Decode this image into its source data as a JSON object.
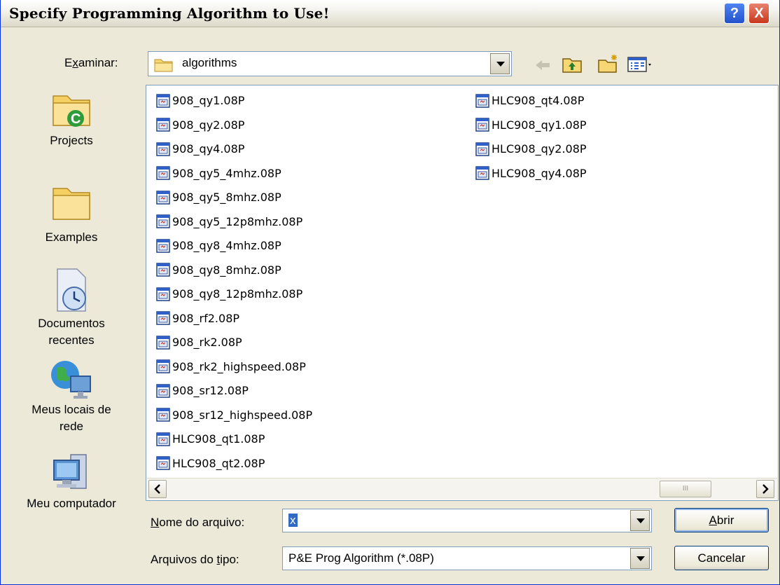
{
  "window": {
    "title": "Specify Programming Algorithm to Use!"
  },
  "titlebar_buttons": {
    "help": "?",
    "close": "X"
  },
  "look_in": {
    "label_pre": "E",
    "label_ul": "x",
    "label_post": "aminar:",
    "value": "algorithms"
  },
  "toolbar": {
    "icons": [
      "back-icon",
      "up-folder-icon",
      "new-folder-icon",
      "view-menu-icon"
    ]
  },
  "places": [
    {
      "label": "Projects",
      "icon": "projects-folder-icon"
    },
    {
      "label": "Examples",
      "icon": "folder-icon"
    },
    {
      "label": "Documentos recentes",
      "icon": "recent-documents-icon"
    },
    {
      "label": "Meus locais de rede",
      "icon": "network-places-icon"
    },
    {
      "label": "Meu computador",
      "icon": "my-computer-icon"
    }
  ],
  "files": {
    "column1": [
      "908_qy1.08P",
      "908_qy2.08P",
      "908_qy4.08P",
      "908_qy5_4mhz.08P",
      "908_qy5_8mhz.08P",
      "908_qy5_12p8mhz.08P",
      "908_qy8_4mhz.08P",
      "908_qy8_8mhz.08P",
      "908_qy8_12p8mhz.08P",
      "908_rf2.08P",
      "908_rk2.08P",
      "908_rk2_highspeed.08P",
      "908_sr12.08P",
      "908_sr12_highspeed.08P",
      "HLC908_qt1.08P",
      "HLC908_qt2.08P"
    ],
    "column2": [
      "HLC908_qt4.08P",
      "HLC908_qy1.08P",
      "HLC908_qy2.08P",
      "HLC908_qy4.08P"
    ]
  },
  "scrollbar": {
    "thumb_grip": "III"
  },
  "filename": {
    "label_ul": "N",
    "label_rest": "ome do arquivo:",
    "value": "x"
  },
  "filetype": {
    "label_pre": "Arquivos do ",
    "label_ul": "t",
    "label_post": "ipo:",
    "value": "P&E Prog Algorithm (*.08P)"
  },
  "buttons": {
    "open_ul": "A",
    "open_rest": "brir",
    "cancel": "Cancelar"
  }
}
